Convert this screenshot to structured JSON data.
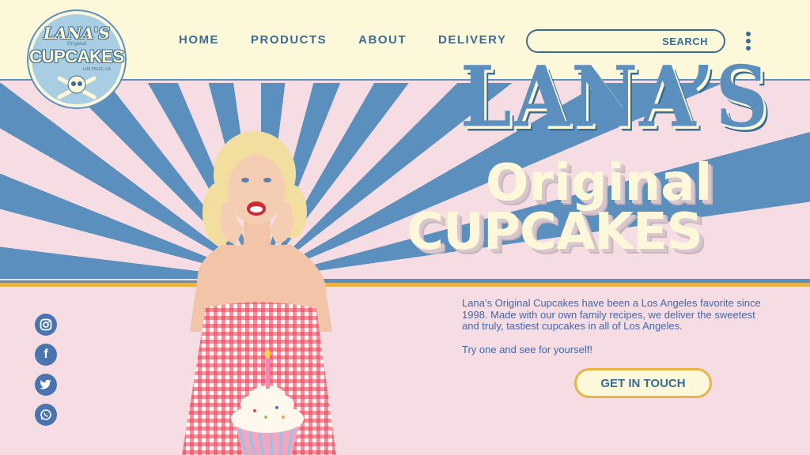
{
  "logo": {
    "title": "LANA'S",
    "sub": "Original",
    "main": "CUPCAKES",
    "location": "LOS FELIZ, CA"
  },
  "nav": {
    "home": "HOME",
    "products": "PRODUCTS",
    "about": "ABOUT",
    "delivery": "DELIVERY"
  },
  "search": {
    "label": "SEARCH",
    "placeholder": ""
  },
  "hero": {
    "brand": "LANA’S",
    "line1": "Original",
    "line2": "CUPCAKES"
  },
  "description": {
    "p1": "Lana’s Original Cupcakes have been a Los Angeles favorite since 1998. Made with our own family recipes, we deliver the sweetest and truly, tastiest cupcakes in all of Los Angeles.",
    "p2": "Try one and see for yourself!"
  },
  "cta": {
    "label": "GET IN TOUCH"
  },
  "social": [
    "instagram-icon",
    "facebook-icon",
    "twitter-icon",
    "whatsapp-icon"
  ],
  "colors": {
    "accent": "#3a6d93",
    "ray_blue": "#5b8fbd",
    "pink": "#f6dde3",
    "cream": "#fdf8d9",
    "gold": "#e8b447"
  }
}
